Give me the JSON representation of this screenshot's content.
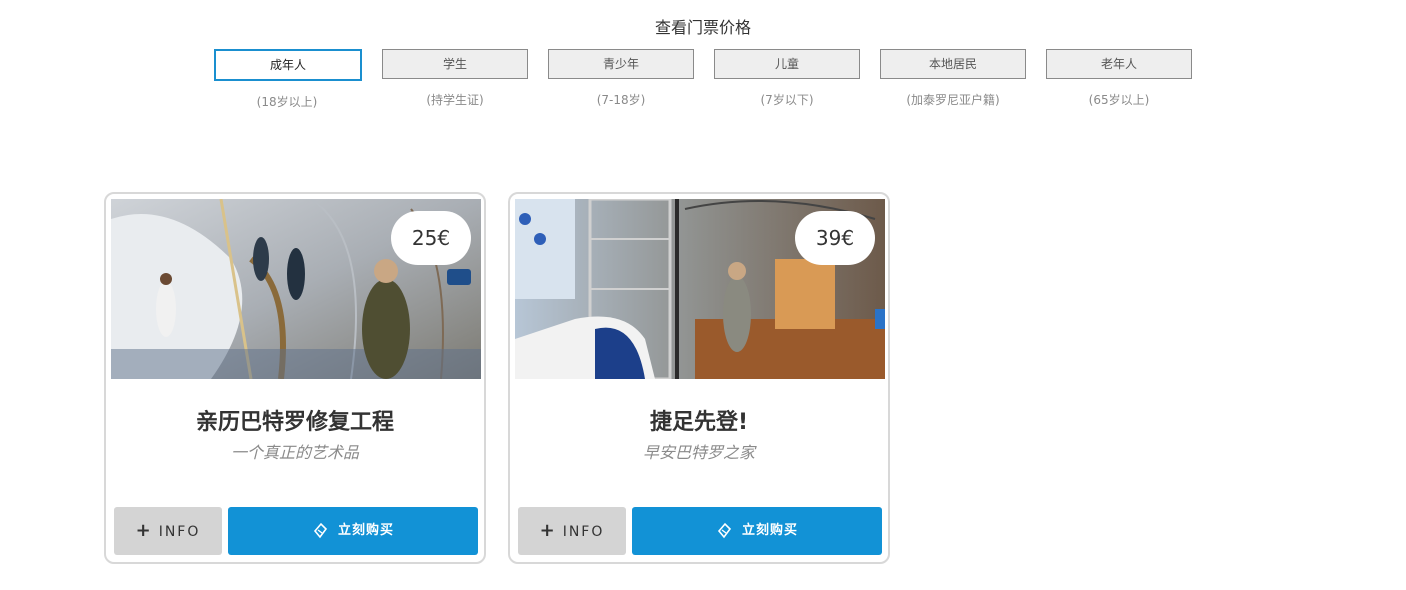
{
  "section": {
    "title": "查看门票价格"
  },
  "tabs": [
    {
      "label": "成年人",
      "sub": "(18岁以上)",
      "active": true
    },
    {
      "label": "学生",
      "sub": "(持学生证)"
    },
    {
      "label": "青少年",
      "sub": "(7-18岁)"
    },
    {
      "label": "儿童",
      "sub": "(7岁以下)"
    },
    {
      "label": "本地居民",
      "sub": "(加泰罗尼亚户籍)"
    },
    {
      "label": "老年人",
      "sub": "(65岁以上)"
    }
  ],
  "cards": [
    {
      "price": "25€",
      "title": "亲历巴特罗修复工程",
      "subtitle": "一个真正的艺术品",
      "info_label": "INFO",
      "buy_label": "立刻购买"
    },
    {
      "price": "39€",
      "title": "捷足先登!",
      "subtitle": "早安巴特罗之家",
      "info_label": "INFO",
      "buy_label": "立刻购买"
    }
  ],
  "colors": {
    "accent": "#1292d6",
    "active_border": "#1a8fcf",
    "info_bg": "#d4d4d4"
  },
  "icons": {
    "plus": "plus-icon",
    "ticket": "ticket-icon"
  }
}
